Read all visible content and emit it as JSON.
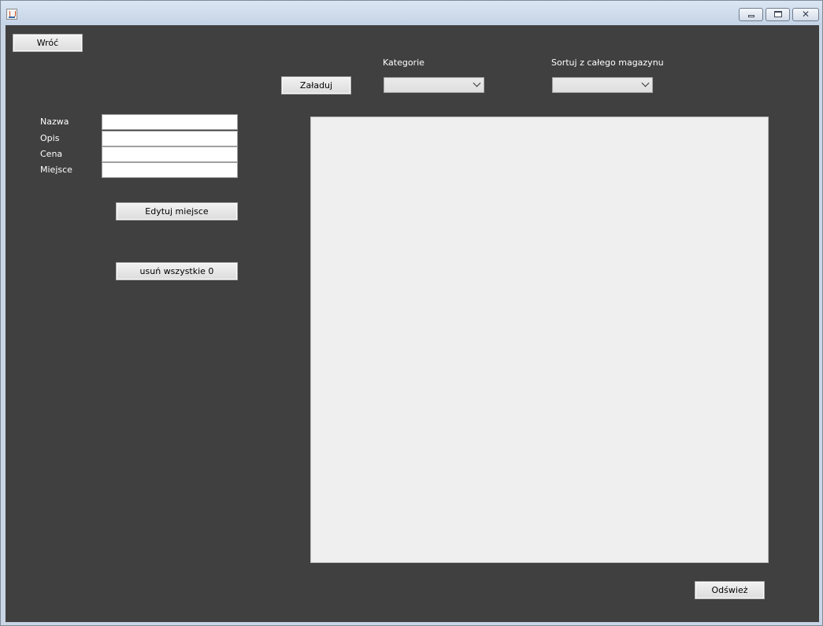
{
  "window": {
    "icon": "java-cup-icon",
    "controls": {
      "minimize_icon": "minimize-icon",
      "maximize_icon": "maximize-icon",
      "close_icon": "close-icon",
      "close_glyph": "✕"
    }
  },
  "toolbar": {
    "back_label": "Wróć",
    "load_label": "Załaduj",
    "categories_label": "Kategorie",
    "categories_selected": "",
    "sort_label": "Sortuj z całego magazynu",
    "sort_selected": ""
  },
  "form": {
    "name_label": "Nazwa",
    "name_value": "",
    "description_label": "Opis",
    "description_value": "",
    "price_label": "Cena",
    "price_value": "",
    "place_label": "Miejsce",
    "place_value": "",
    "edit_place_label": "Edytuj miejsce",
    "delete_all_label": "usuń wszystkie 0"
  },
  "footer": {
    "refresh_label": "Odśwież"
  },
  "colors": {
    "background": "#404040",
    "panel": "#efefef",
    "label_text": "#ffffff"
  }
}
